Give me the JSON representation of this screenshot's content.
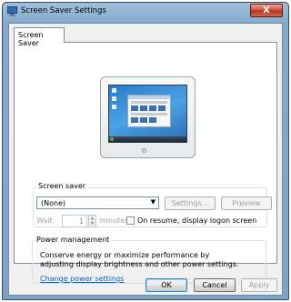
{
  "window": {
    "title": "Screen Saver Settings",
    "close_glyph": "X"
  },
  "tabs": [
    {
      "label": "Screen Saver",
      "selected": true
    }
  ],
  "screen_saver": {
    "group_label": "Screen saver",
    "selected_option": "(None)",
    "settings_button": "Settings...",
    "preview_button": "Preview",
    "wait_label": "Wait:",
    "wait_value": "1",
    "minutes_label": "minutes",
    "resume_checkbox_label": "On resume, display logon screen",
    "resume_checked": false
  },
  "power_management": {
    "group_label": "Power management",
    "description": "Conserve energy or maximize performance by adjusting display brightness and other power settings.",
    "link": "Change power settings"
  },
  "footer": {
    "ok": "OK",
    "cancel": "Cancel",
    "apply": "Apply"
  },
  "colors": {
    "title_gradient": "#86abcc",
    "close_button": "#c9412c",
    "link": "#0066cc",
    "disabled_text": "#a0a0a0"
  },
  "icons": {
    "title": "screen-saver-monitor-icon",
    "dropdown": "chevron-down-icon"
  }
}
